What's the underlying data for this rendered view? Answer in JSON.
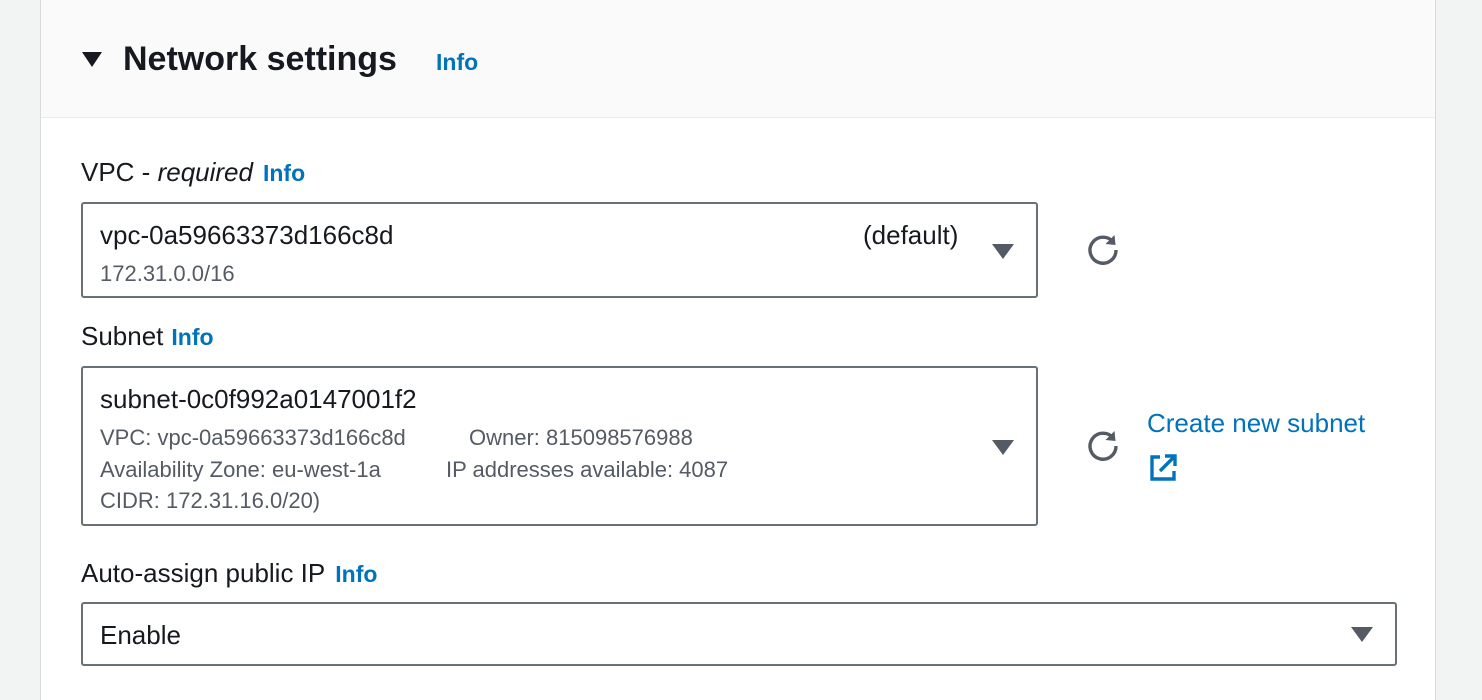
{
  "section": {
    "title": "Network settings",
    "info": "Info",
    "expanded_icon": "caret-down-icon"
  },
  "vpc": {
    "label": "VPC - ",
    "label_required": "required",
    "info": "Info",
    "selected_id": "vpc-0a59663373d166c8d",
    "selected_tag": "(default)",
    "cidr": "172.31.0.0/16",
    "refresh_icon": "refresh-icon",
    "dropdown_icon": "caret-down-icon"
  },
  "subnet": {
    "label": "Subnet",
    "info": "Info",
    "selected_id": "subnet-0c0f992a0147001f2",
    "vpc_line": "VPC: vpc-0a59663373d166c8d",
    "owner_line": "Owner: 815098576988",
    "az_line": "Availability Zone: eu-west-1a",
    "ips_line": "IP addresses available: 4087",
    "cidr_line": "CIDR: 172.31.16.0/20)",
    "refresh_icon": "refresh-icon",
    "create_link": "Create new subnet",
    "external_icon": "external-link-icon"
  },
  "public_ip": {
    "label": "Auto-assign public IP",
    "info": "Info",
    "value": "Enable",
    "dropdown_icon": "caret-down-icon"
  },
  "colors": {
    "link": "#0073bb",
    "text": "#16191f",
    "secondary_text": "#545b64",
    "border": "#687078",
    "page_bg": "#f2f3f3"
  }
}
